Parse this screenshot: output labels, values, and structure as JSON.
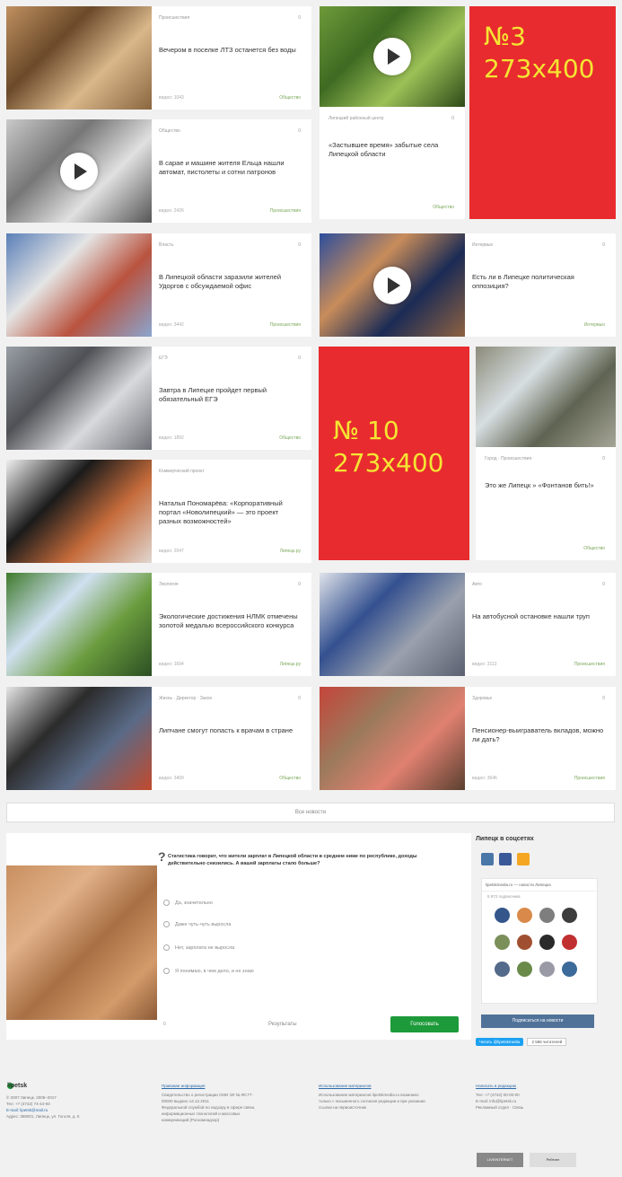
{
  "news": [
    {
      "category": "Происшествия",
      "comments": "0",
      "title": "Вечером в поселке ЛТЗ останется без воды",
      "views": "видео: 1043",
      "rubric": "Общество",
      "video": false,
      "img_colors": [
        "#c09060",
        "#6b4a2a",
        "#d9b78a",
        "#8a6640"
      ]
    },
    {
      "category": "Общество",
      "comments": "0",
      "title": "В сарае и машине жителя Ельца нашли автомат, пистолеты и сотни патронов",
      "views": "видео: 2426",
      "rubric": "Происшествия",
      "video": true,
      "img_colors": [
        "#c9c9c9",
        "#777",
        "#e0e0e0",
        "#555"
      ]
    },
    {
      "category": "Власть",
      "comments": "0",
      "title": "В Липецкой области заразили жителей Удоргов с обсуждаемой офис",
      "views": "видео: 3442",
      "rubric": "Происшествия",
      "video": false,
      "img_colors": [
        "#5a7fb8",
        "#e4e4e4",
        "#b9533f",
        "#8aa5cf"
      ]
    },
    {
      "category": "ЕГЭ",
      "comments": "0",
      "title": "Завтра в Липецке пройдет первый обязательный ЕГЭ",
      "views": "видео: 1892",
      "rubric": "Общество",
      "video": false,
      "img_colors": [
        "#9aa0a6",
        "#4f5156",
        "#d7d9dc",
        "#6d7076"
      ]
    },
    {
      "category": "Коммерческий проект",
      "comments": "",
      "title": "Наталья Пономарёва: «Корпоративный портал «Новолипецкий» — это проект разных возможностей»",
      "views": "видео: 2047",
      "rubric": "Липецк.ру",
      "video": false,
      "img_colors": [
        "#f0f0f0",
        "#1b1b1b",
        "#c56b3b",
        "#e0d6d0"
      ]
    },
    {
      "category": "Экология",
      "comments": "0",
      "title": "Экологические достижения НЛМК отмечены золотой медалью всероссийского конкурса",
      "views": "видео: 1694",
      "rubric": "Липецк.ру",
      "video": false,
      "img_colors": [
        "#3f7a2c",
        "#cfe0f0",
        "#6a9c3e",
        "#2c4f23"
      ]
    },
    {
      "category": "Жизнь · Директор · Закон",
      "comments": "0",
      "title": "Липчане смогут попасть к врачам в стране",
      "views": "видео: 3409",
      "rubric": "Общество",
      "video": false,
      "img_colors": [
        "#e5e5e5",
        "#2b2b2b",
        "#5a6a86",
        "#c24a2d"
      ]
    }
  ],
  "news_right": [
    {
      "category": "Липецкий районный центр",
      "comments": "0",
      "title": "«Застывшее время» забытые села Липецкой области",
      "views": "",
      "rubric": "Общество",
      "video": true,
      "img_colors": [
        "#6e9a3a",
        "#3e6a22",
        "#9cc057",
        "#2e4a18"
      ]
    },
    {
      "category": "Интервью",
      "comments": "0",
      "title": "Есть ли в Липецке политическая оппозиция?",
      "views": "",
      "rubric": "Интервью",
      "video": true,
      "img_colors": [
        "#2d4e9c",
        "#c88c5a",
        "#1b2b55",
        "#8e6242"
      ]
    },
    {
      "category": "Город · Происшествия",
      "comments": "0",
      "title": "Это же Липецк » «Фонтанов бить!»",
      "views": "",
      "rubric": "Общество",
      "video": false,
      "img_colors": [
        "#8b8b7a",
        "#d7dee0",
        "#5f6351",
        "#a5a596"
      ]
    },
    {
      "category": "Авто",
      "comments": "0",
      "title": "На автобусной остановке нашли труп",
      "views": "видео: 3113",
      "rubric": "Происшествия",
      "video": false,
      "img_colors": [
        "#dfe3ea",
        "#34508f",
        "#9aa1ad",
        "#5a6070"
      ]
    },
    {
      "category": "Здоровье",
      "comments": "0",
      "title": "Пенсионер-выиграватель вкладов, можно ли дать?",
      "views": "видео: 3646",
      "rubric": "Происшествия",
      "video": false,
      "img_colors": [
        "#c4453a",
        "#9c7a5c",
        "#e08070",
        "#5a4030"
      ]
    }
  ],
  "ads": [
    {
      "number": "№3",
      "size": "273x400"
    },
    {
      "number": "№ 10",
      "size": "273x400"
    }
  ],
  "all_news_label": "Все новости",
  "poll": {
    "question": "Статистика говорит, что жители зарплат в Липецкой области в среднем ниже по республике, доходы действительно снизились. А вашей зарплаты стало больше?",
    "options": [
      "Да, значительно",
      "Даже чуть-чуть выросла",
      "Нет, зарплата не выросла",
      "Я понимаю, в чем дело, и не знаю"
    ],
    "count": "0",
    "results_label": "Результаты",
    "vote_label": "Голосовать"
  },
  "social": {
    "title": "Липецк в соцсетях",
    "tab_colors": [
      "#4a76a8",
      "#3b5998",
      "#f5a623"
    ],
    "group_name": "lipetskmedia.ru — новости Липецка",
    "subscribers": "5 972 подписчика",
    "avatar_colors": [
      "#34568b",
      "#d98a4a",
      "#7e7e7e",
      "#3d3d3d",
      "#7a8f5a",
      "#a05030",
      "#2a2a2a",
      "#c03030",
      "#546a8a",
      "#6a8a4a",
      "#9a9aa6",
      "#3c6a9a"
    ],
    "subscribe_label": "Подписаться на новости",
    "tweet_label": "Читать @lipetskmedia",
    "tweet_count": "2 586 читателей"
  },
  "footer": {
    "logo": "lipetsk",
    "col1": [
      "© 2007 Липецк. 2005–2017",
      "Тел: +7 (4742) 74-44-93",
      "E-mail: lipetsk@mail.ru",
      "Адрес: 398001, Липецк, ул. Гоголя, д. 5"
    ],
    "col2_head": "Правовая информация",
    "col2": [
      "Свидетельство о регистрации СМИ ЭЛ № ФС77-",
      "00000 выдано 14.12.2011",
      "Федеральной службой по надзору в сфере связи,",
      "информационных технологий и массовых",
      "коммуникаций (Роскомнадзор)"
    ],
    "col3_head": "Использование материалов",
    "col3": [
      "Использование материалов lipetskmedia.ru возможно",
      "только с письменного согласия редакции и при указании",
      "ссылки на первоисточник"
    ],
    "col4_head": "Написать в редакцию",
    "col4": [
      "Тел: +7 (4742) 00-00-00",
      "E-mail: info@lipetsk.ru",
      "",
      "Рекламный отдел · Связь"
    ],
    "counters": [
      "LIVEINTERNET",
      "Рейтинг"
    ]
  }
}
